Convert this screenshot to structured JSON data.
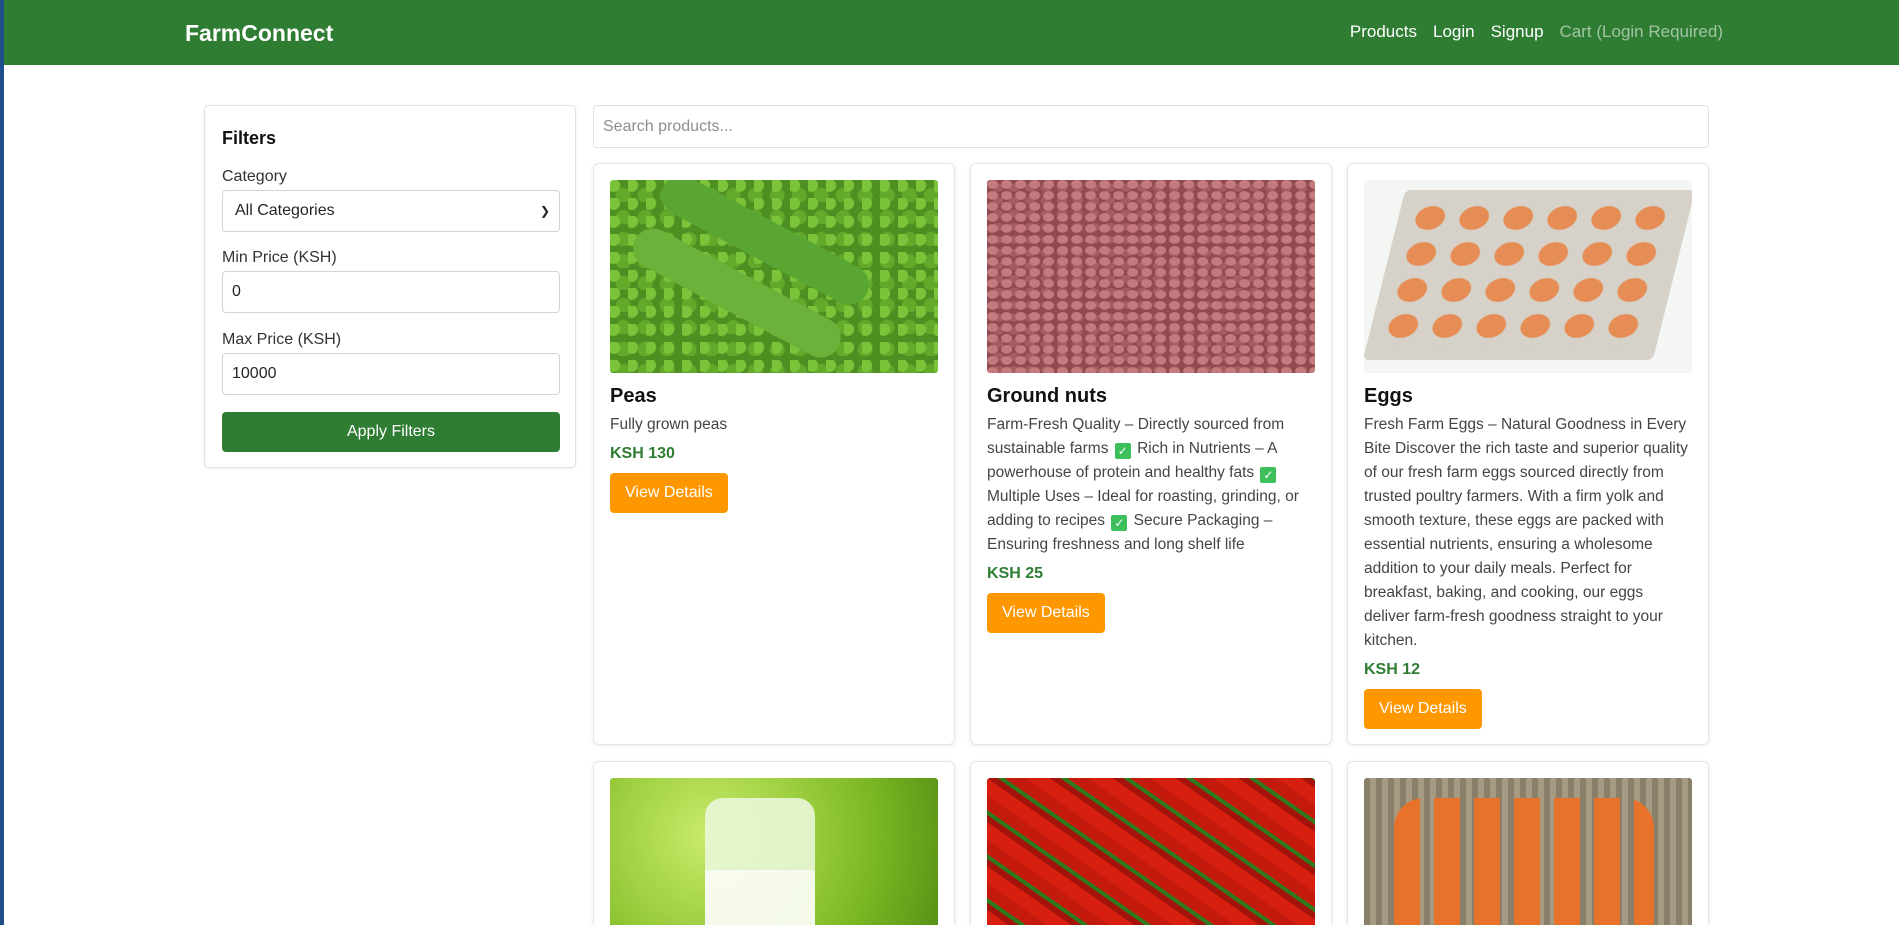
{
  "navbar": {
    "brand": "FarmConnect",
    "links": [
      "Products",
      "Login",
      "Signup"
    ],
    "cart": "Cart (Login Required)",
    "color": "#2e7d32"
  },
  "filters": {
    "title": "Filters",
    "category_label": "Category",
    "category_value": "All Categories",
    "min_label": "Min Price (KSH)",
    "min_value": "0",
    "max_label": "Max Price (KSH)",
    "max_value": "10000",
    "apply_label": "Apply Filters"
  },
  "search": {
    "placeholder": "Search products..."
  },
  "products": [
    {
      "name": "Peas",
      "description": "Fully grown peas",
      "price": "KSH 130",
      "button": "View Details"
    },
    {
      "name": "Ground nuts",
      "desc_parts": [
        "Farm-Fresh Quality – Directly sourced from sustainable farms ",
        " Rich in Nutrients – A powerhouse of protein and healthy fats ",
        " Multiple Uses – Ideal for roasting, grinding, or adding to recipes ",
        " Secure Packaging – Ensuring freshness and long shelf life"
      ],
      "price": "KSH 25",
      "button": "View Details"
    },
    {
      "name": "Eggs",
      "description": "Fresh Farm Eggs – Natural Goodness in Every Bite Discover the rich taste and superior quality of our fresh farm eggs sourced directly from trusted poultry farmers. With a firm yolk and smooth texture, these eggs are packed with essential nutrients, ensuring a wholesome addition to your daily meals. Perfect for breakfast, baking, and cooking, our eggs deliver farm-fresh goodness straight to your kitchen.",
      "price": "KSH 12",
      "button": "View Details"
    }
  ],
  "accent_button_color": "#ff9800"
}
